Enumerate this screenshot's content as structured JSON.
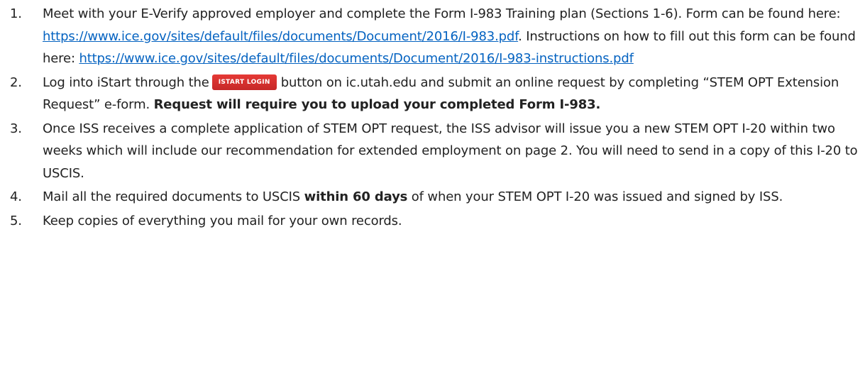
{
  "steps": [
    {
      "number": "1.",
      "t1": "Meet with your E-Verify approved employer and complete the Form I-983 Training plan (Sections 1-6). Form can be found here: ",
      "link1": "https://www.ice.gov/sites/default/files/documents/Document/2016/I-983.pdf",
      "t2": ". Instructions on how to fill out this form can be found here: ",
      "link2": "https://www.ice.gov/sites/default/files/documents/Document/2016/I-983-instructions.pdf"
    },
    {
      "number": "2.",
      "t1": "Log into iStart through the",
      "button": "iSTART LOGIN",
      "t2": "button on ic.utah.edu and submit an online request by completing “STEM OPT Extension Request” e-form. ",
      "bold": "Request will require you to upload your completed Form I-983."
    },
    {
      "number": "3.",
      "t1": "Once ISS receives a complete application of STEM OPT request, the ISS advisor will issue you a new STEM OPT I-20 within two weeks which will include our recommendation for extended employment on page 2. You will need to send in a copy of this I-20 to USCIS."
    },
    {
      "number": "4.",
      "t1": "Mail all the required documents to USCIS ",
      "bold": "within 60 days",
      "t2": " of when your STEM OPT I-20 was issued and signed by ISS."
    },
    {
      "number": "5.",
      "t1": "Keep copies of everything you mail for your own records."
    }
  ],
  "colors": {
    "link": "#0563c1",
    "button_bg": "#d32f2f",
    "text": "#222222"
  }
}
